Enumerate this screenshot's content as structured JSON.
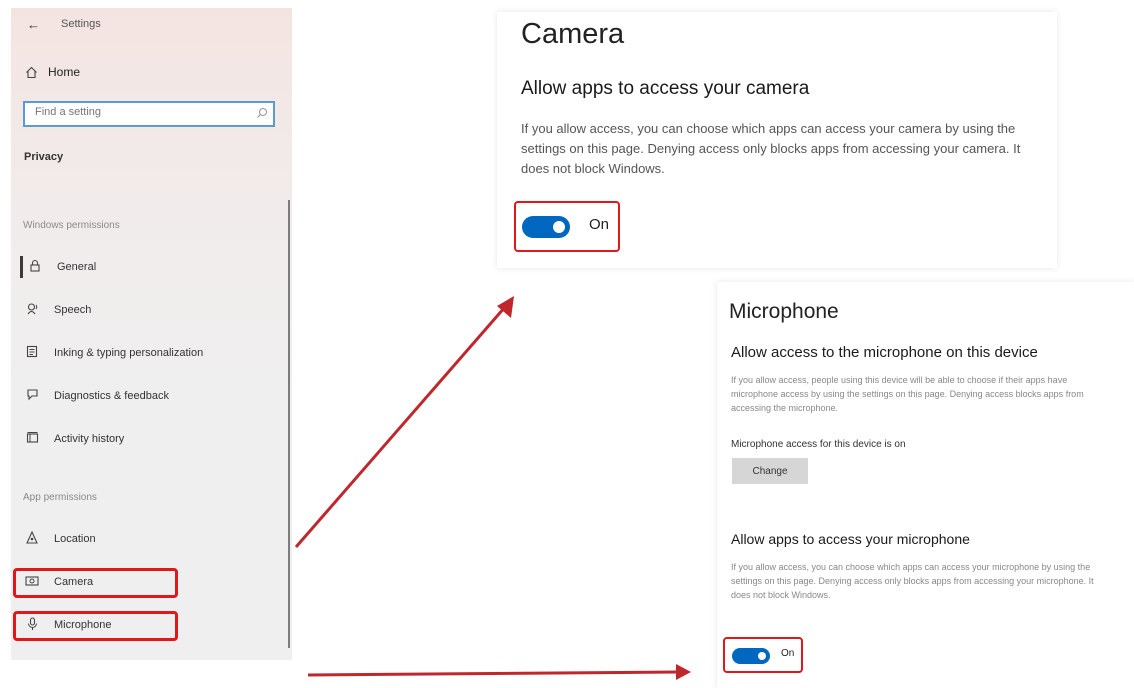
{
  "sidebar": {
    "back_glyph": "←",
    "title": "Settings",
    "home": {
      "icon": "home-icon",
      "label": "Home"
    },
    "search": {
      "placeholder": "Find a setting",
      "icon": "search-icon"
    },
    "privacy": "Privacy",
    "windows_permissions_header": "Windows permissions",
    "windows_items": [
      {
        "icon": "lock-icon",
        "label": "General"
      },
      {
        "icon": "speech-icon",
        "label": "Speech"
      },
      {
        "icon": "inking-icon",
        "label": "Inking & typing personalization"
      },
      {
        "icon": "diagnostics-icon",
        "label": "Diagnostics & feedback"
      },
      {
        "icon": "activity-icon",
        "label": "Activity history"
      }
    ],
    "app_permissions_header": "App permissions",
    "app_items": [
      {
        "icon": "location-icon",
        "label": "Location"
      },
      {
        "icon": "camera-icon",
        "label": "Camera"
      },
      {
        "icon": "microphone-icon",
        "label": "Microphone"
      }
    ]
  },
  "camera": {
    "title": "Camera",
    "subtitle": "Allow apps to access your camera",
    "description": "If you allow access, you can choose which apps can access your camera by using the settings on this page. Denying access only blocks apps from accessing your camera. It does not block Windows.",
    "toggle_label": "On",
    "toggle_on": true
  },
  "microphone": {
    "title": "Microphone",
    "device_subtitle": "Allow access to the microphone on this device",
    "device_description": "If you allow access, people using this device will be able to choose if their apps have microphone access by using the settings on this page. Denying access blocks apps from accessing the microphone.",
    "device_status": "Microphone access for this device is on",
    "change_button": "Change",
    "apps_subtitle": "Allow apps to access your microphone",
    "apps_description": "If you allow access, you can choose which apps can access your microphone by using the settings on this page. Denying access only blocks apps from accessing your microphone. It does not block Windows.",
    "toggle_label": "On",
    "toggle_on": true
  },
  "colors": {
    "highlight": "#e0181b",
    "toggle_on": "#0067c0",
    "arrow": "#c0272d"
  }
}
